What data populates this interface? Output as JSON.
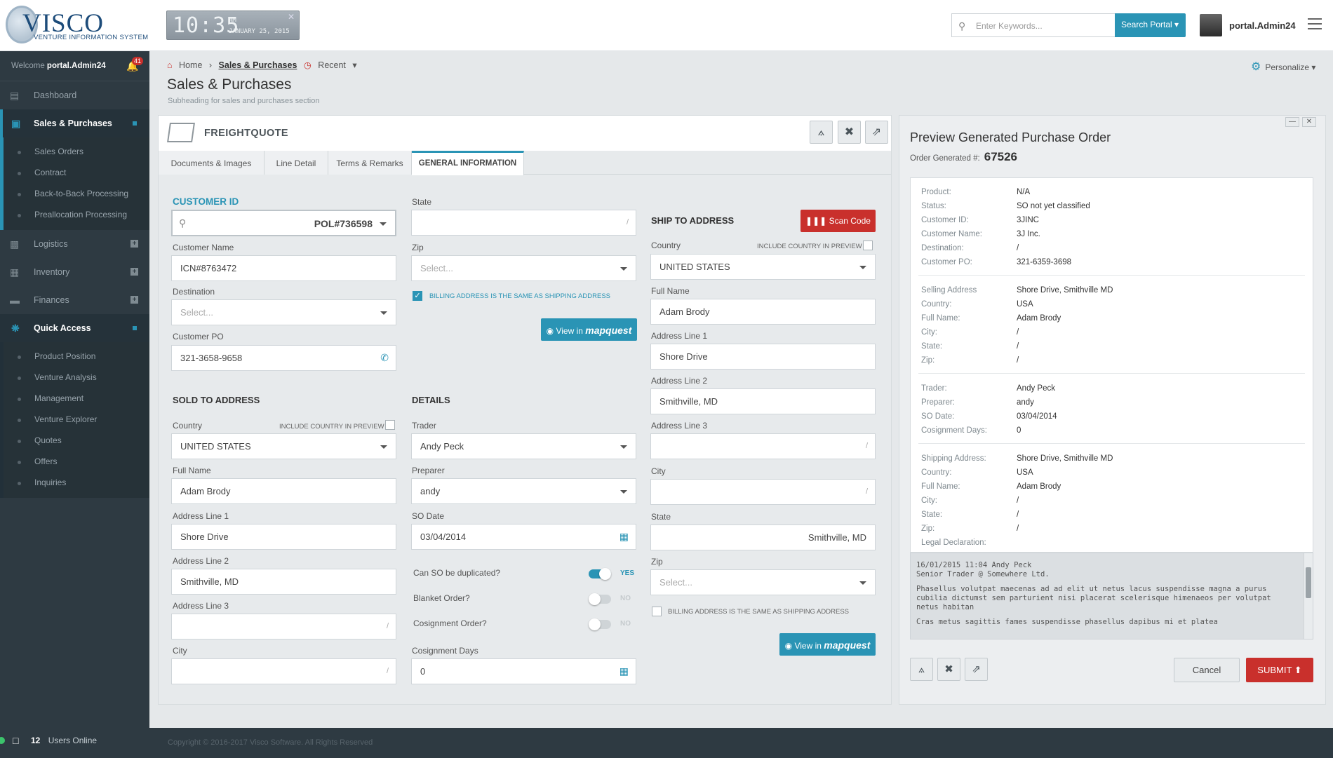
{
  "app": {
    "name": "VISCO",
    "subtitle": "VENTURE INFORMATION SYSTEM"
  },
  "clock": {
    "time": "10:35",
    "ampm": "AM",
    "date": "JANUARY 25, 2015"
  },
  "search": {
    "placeholder": "Enter Keywords...",
    "button": "Search Portal"
  },
  "user": {
    "name": "portal.Admin24"
  },
  "sidebar": {
    "welcome": "Welcome",
    "username": "portal.Admin24",
    "notifications": "41",
    "items": [
      {
        "label": "Dashboard",
        "icon": "laptop-icon"
      },
      {
        "label": "Sales  & Purchases",
        "icon": "briefcase-icon",
        "active": true
      },
      {
        "label": "Logistics",
        "icon": "truck-icon"
      },
      {
        "label": "Inventory",
        "icon": "clipboard-icon"
      },
      {
        "label": "Finances",
        "icon": "bar-chart-icon"
      },
      {
        "label": "Quick Access",
        "icon": "lifebuoy-icon"
      }
    ],
    "sales_sub": [
      "Sales Orders",
      "Contract",
      "Back-to-Back Processing",
      "Preallocation Processing"
    ],
    "quick_sub": [
      "Product Position",
      "Venture Analysis",
      "Management",
      "Venture Explorer",
      "Quotes",
      "Offers",
      "Inquiries"
    ],
    "users_count": "12",
    "users_label": "Users Online"
  },
  "breadcrumb": {
    "home": "Home",
    "current": "Sales & Purchases",
    "recent": "Recent"
  },
  "page": {
    "title": "Sales & Purchases",
    "subtitle": "Subheading for sales and purchases section",
    "personalize": "Personalize"
  },
  "panel": {
    "brand": "FREIGHTQUOTE",
    "tabs": [
      "Documents & Images",
      "Line Detail",
      "Terms & Remarks",
      "GENERAL INFORMATION"
    ],
    "active_tab": "GENERAL INFORMATION"
  },
  "form": {
    "customer_id_label": "CUSTOMER ID",
    "customer_id": "POL#736598",
    "customer_name_label": "Customer Name",
    "customer_name": "ICN#8763472",
    "destination_label": "Destination",
    "select_placeholder": "Select...",
    "customer_po_label": "Customer PO",
    "customer_po": "321-3658-9658",
    "state_label": "State",
    "zip_label": "Zip",
    "billing_same": "BILLING ADDRESS IS THE SAME AS SHIPPING ADDRESS",
    "view_in": "View in",
    "mapquest": "mapquest",
    "sold_to": {
      "title": "SOLD TO ADDRESS",
      "country_label": "Country",
      "include_country": "INCLUDE COUNTRY IN PREVIEW",
      "country": "UNITED STATES",
      "full_name_label": "Full Name",
      "full_name": "Adam Brody",
      "addr1_label": "Address Line 1",
      "addr1": "Shore Drive",
      "addr2_label": "Address Line 2",
      "addr2": "Smithville, MD",
      "addr3_label": "Address Line 3",
      "city_label": "City"
    },
    "details": {
      "title": "DETAILS",
      "trader_label": "Trader",
      "trader": "Andy Peck",
      "preparer_label": "Preparer",
      "preparer": "andy",
      "so_date_label": "SO Date",
      "so_date": "03/04/2014",
      "dup_label": "Can SO be duplicated?",
      "dup_value": "YES",
      "blanket_label": "Blanket Order?",
      "blanket_value": "NO",
      "consign_label": "Cosignment Order?",
      "consign_value": "NO",
      "consign_days_label": "Cosignment Days",
      "consign_days": "0"
    },
    "ship_to": {
      "title": "SHIP TO ADDRESS",
      "scan": "Scan Code",
      "country_label": "Country",
      "include_country": "INCLUDE COUNTRY IN PREVIEW",
      "country": "UNITED STATES",
      "full_name_label": "Full Name",
      "full_name": "Adam Brody",
      "addr1_label": "Address Line 1",
      "addr1": "Shore Drive",
      "addr2_label": "Address Line 2",
      "addr2": "Smithville, MD",
      "addr3_label": "Address Line 3",
      "city_label": "City",
      "state_label": "State",
      "state": "Smithville, MD",
      "zip_label": "Zip"
    }
  },
  "preview": {
    "title": "Preview Generated Purchase Order",
    "order_label": "Order Generated #:",
    "order_no": "67526",
    "rows": [
      {
        "k": "Product:",
        "v": "N/A"
      },
      {
        "k": "Status:",
        "v": "SO not yet classified"
      },
      {
        "k": "Customer ID:",
        "v": "3JINC"
      },
      {
        "k": "Customer Name:",
        "v": "3J Inc."
      },
      {
        "k": "Destination:",
        "v": "/"
      },
      {
        "k": "Customer PO:",
        "v": "321-6359-3698"
      },
      {
        "k": "Selling Address",
        "v": "Shore Drive, Smithville MD"
      },
      {
        "k": "Country:",
        "v": "USA"
      },
      {
        "k": "Full Name:",
        "v": "Adam Brody"
      },
      {
        "k": "City:",
        "v": "/"
      },
      {
        "k": "State:",
        "v": "/"
      },
      {
        "k": "Zip:",
        "v": "/"
      },
      {
        "k": "Trader:",
        "v": "Andy Peck"
      },
      {
        "k": "Preparer:",
        "v": "andy"
      },
      {
        "k": "SO Date:",
        "v": "03/04/2014"
      },
      {
        "k": "Cosignment Days:",
        "v": "0"
      },
      {
        "k": "Shipping Address:",
        "v": "Shore Drive, Smithville MD"
      },
      {
        "k": "Country:",
        "v": "USA"
      },
      {
        "k": "Full Name:",
        "v": "Adam Brody"
      },
      {
        "k": "City:",
        "v": "/"
      },
      {
        "k": "State:",
        "v": "/"
      },
      {
        "k": "Zip:",
        "v": "/"
      },
      {
        "k": "Legal Declaration:",
        "v": ""
      }
    ],
    "legal_head1": "16/01/2015 11:04 Andy Peck",
    "legal_head2": "Senior Trader @ Somewhere Ltd.",
    "legal_p1": "Phasellus volutpat maecenas ad ad elit ut netus lacus suspendisse magna a purus cubilia dictumst sem parturient nisi placerat scelerisque himenaeos per volutpat netus habitan",
    "legal_p2": "Cras metus sagittis fames suspendisse phasellus dapibus mi et platea",
    "cancel": "Cancel",
    "submit": "SUBMIT"
  },
  "footer": {
    "copyright": "Copyright © 2016-2017 Visco Software. All Rights Reserved"
  },
  "colors": {
    "accent": "#2a94b5",
    "danger": "#c9302c",
    "sidebar": "#2e3a42"
  }
}
